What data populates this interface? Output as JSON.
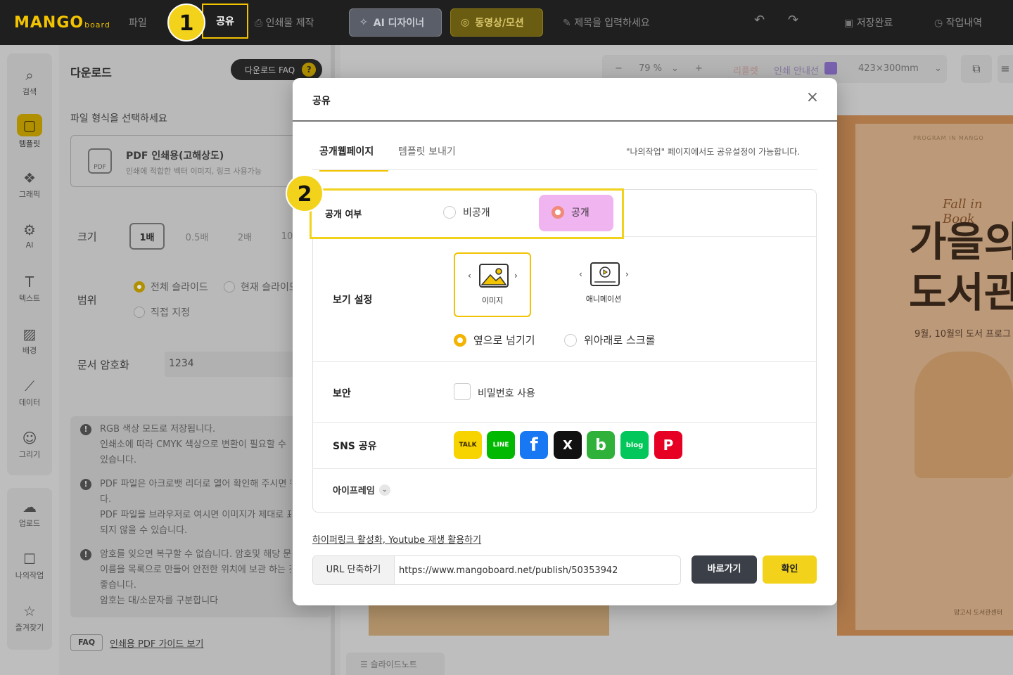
{
  "topbar": {
    "logo": "MANGO",
    "logo_suffix": "board",
    "file": "파일",
    "share": "공유",
    "print": "인쇄물 제작",
    "ai_designer": "AI 디자이너",
    "video_motion": "동영상/모션",
    "title_placeholder": "제목을 입력하세요",
    "saved": "저장완료",
    "history": "작업내역"
  },
  "sidebar": {
    "items": [
      {
        "label": "검색",
        "icon": "search-icon"
      },
      {
        "label": "템플릿",
        "icon": "template-icon"
      },
      {
        "label": "그래픽",
        "icon": "graphic-icon"
      },
      {
        "label": "AI",
        "icon": "ai-icon"
      },
      {
        "label": "텍스트",
        "icon": "text-icon"
      },
      {
        "label": "배경",
        "icon": "background-icon"
      },
      {
        "label": "데이터",
        "icon": "chart-icon"
      },
      {
        "label": "그리기",
        "icon": "draw-icon"
      }
    ],
    "items2": [
      {
        "label": "업로드",
        "icon": "upload-icon"
      },
      {
        "label": "나의작업",
        "icon": "my-work-icon"
      },
      {
        "label": "즐겨찾기",
        "icon": "favorite-icon"
      }
    ]
  },
  "download_panel": {
    "title": "다운로드",
    "faq_label": "다운로드 FAQ",
    "format_prompt": "파일 형식을 선택하세요",
    "format_icon_text": "PDF",
    "format_title": "PDF 인쇄용(고해상도)",
    "format_desc": "인쇄에 적합한 벡터 이미지, 링크 사용가능",
    "size_label": "크기",
    "sizes": [
      "1배",
      "0.5배",
      "2배",
      "10"
    ],
    "range_label": "범위",
    "range_options": [
      "전체 슬라이드",
      "현재 슬라이드",
      "직접 지정"
    ],
    "encrypt_label": "문서 암호화",
    "encrypt_value": "1234",
    "notes": [
      [
        "RGB 색상 모드로 저장됩니다.",
        "인쇄소에 따라 CMYK 색상으로 변환이 필요할 수",
        "있습니다."
      ],
      [
        "PDF 파일은 아크로뱃 리더로 열어 확인해 주시면 됩니",
        "다.",
        "PDF 파일을 브라우저로 여시면 이미지가 제대로 표시",
        "되지 않을 수 있습니다."
      ],
      [
        "암호를 잊으면 복구할 수 없습니다. 암호및 해당 문서",
        "이름을 목록으로 만들어 안전한 위치에 보관 하는 것이",
        "좋습니다.",
        "암호는 대/소문자를 구분합니다"
      ]
    ],
    "faq_tag": "FAQ",
    "faq_link": "인쇄용 PDF 가이드 보기"
  },
  "canvas_toolbar": {
    "zoom_minus": "−",
    "zoom": "79 %",
    "zoom_plus": "+",
    "reflow": "리플렛",
    "print_guide": "인쇄 안내선",
    "size": "423×300mm"
  },
  "poster": {
    "small_text": "PROGRAM IN MANGO",
    "script": "Fall in Book",
    "line1": "가을의",
    "line2": "도서관",
    "subtitle": "9월, 10월의 도서 프로그",
    "bottom": "망고시 도서관센터"
  },
  "slide_notes": "슬라이드노트",
  "modal": {
    "title": "공유",
    "tabs": [
      "공개웹페이지",
      "템플릿 보내기"
    ],
    "note": "\"나의작업\" 페이지에서도 공유설정이 가능합니다.",
    "visibility_label": "공개 여부",
    "visibility_options": [
      "비공개",
      "공개"
    ],
    "view_label": "보기 설정",
    "view_cards": [
      "이미지",
      "애니메이션"
    ],
    "scroll_options": [
      "옆으로 넘기기",
      "위아래로 스크롤"
    ],
    "security_label": "보안",
    "password_option": "비밀번호 사용",
    "sns_label": "SNS 공유",
    "sns": [
      {
        "name": "kakaotalk",
        "text": "TALK",
        "color": "#f7d400"
      },
      {
        "name": "line",
        "text": "LINE",
        "color": "#00b900"
      },
      {
        "name": "facebook",
        "text": "f",
        "color": "#1877f2"
      },
      {
        "name": "x",
        "text": "X",
        "color": "#111111"
      },
      {
        "name": "band",
        "text": "b",
        "color": "#30b23a"
      },
      {
        "name": "blog",
        "text": "blog",
        "color": "#03c75a"
      },
      {
        "name": "pinterest",
        "text": "P",
        "color": "#e60023"
      }
    ],
    "iframe_label": "아이프레임",
    "hyperlink_text": "하이퍼링크 활성화, Youtube 재생 활용하기",
    "url_label": "URL 단축하기",
    "url_value": "https://www.mangoboard.net/publish/50353942",
    "go_button": "바로가기",
    "ok_button": "확인"
  },
  "annotations": {
    "badge1": "1",
    "badge2": "2"
  },
  "colors": {
    "accent": "#f2d21a",
    "highlight_pink": "#f0b4f0",
    "dark": "#1f1f1f"
  }
}
